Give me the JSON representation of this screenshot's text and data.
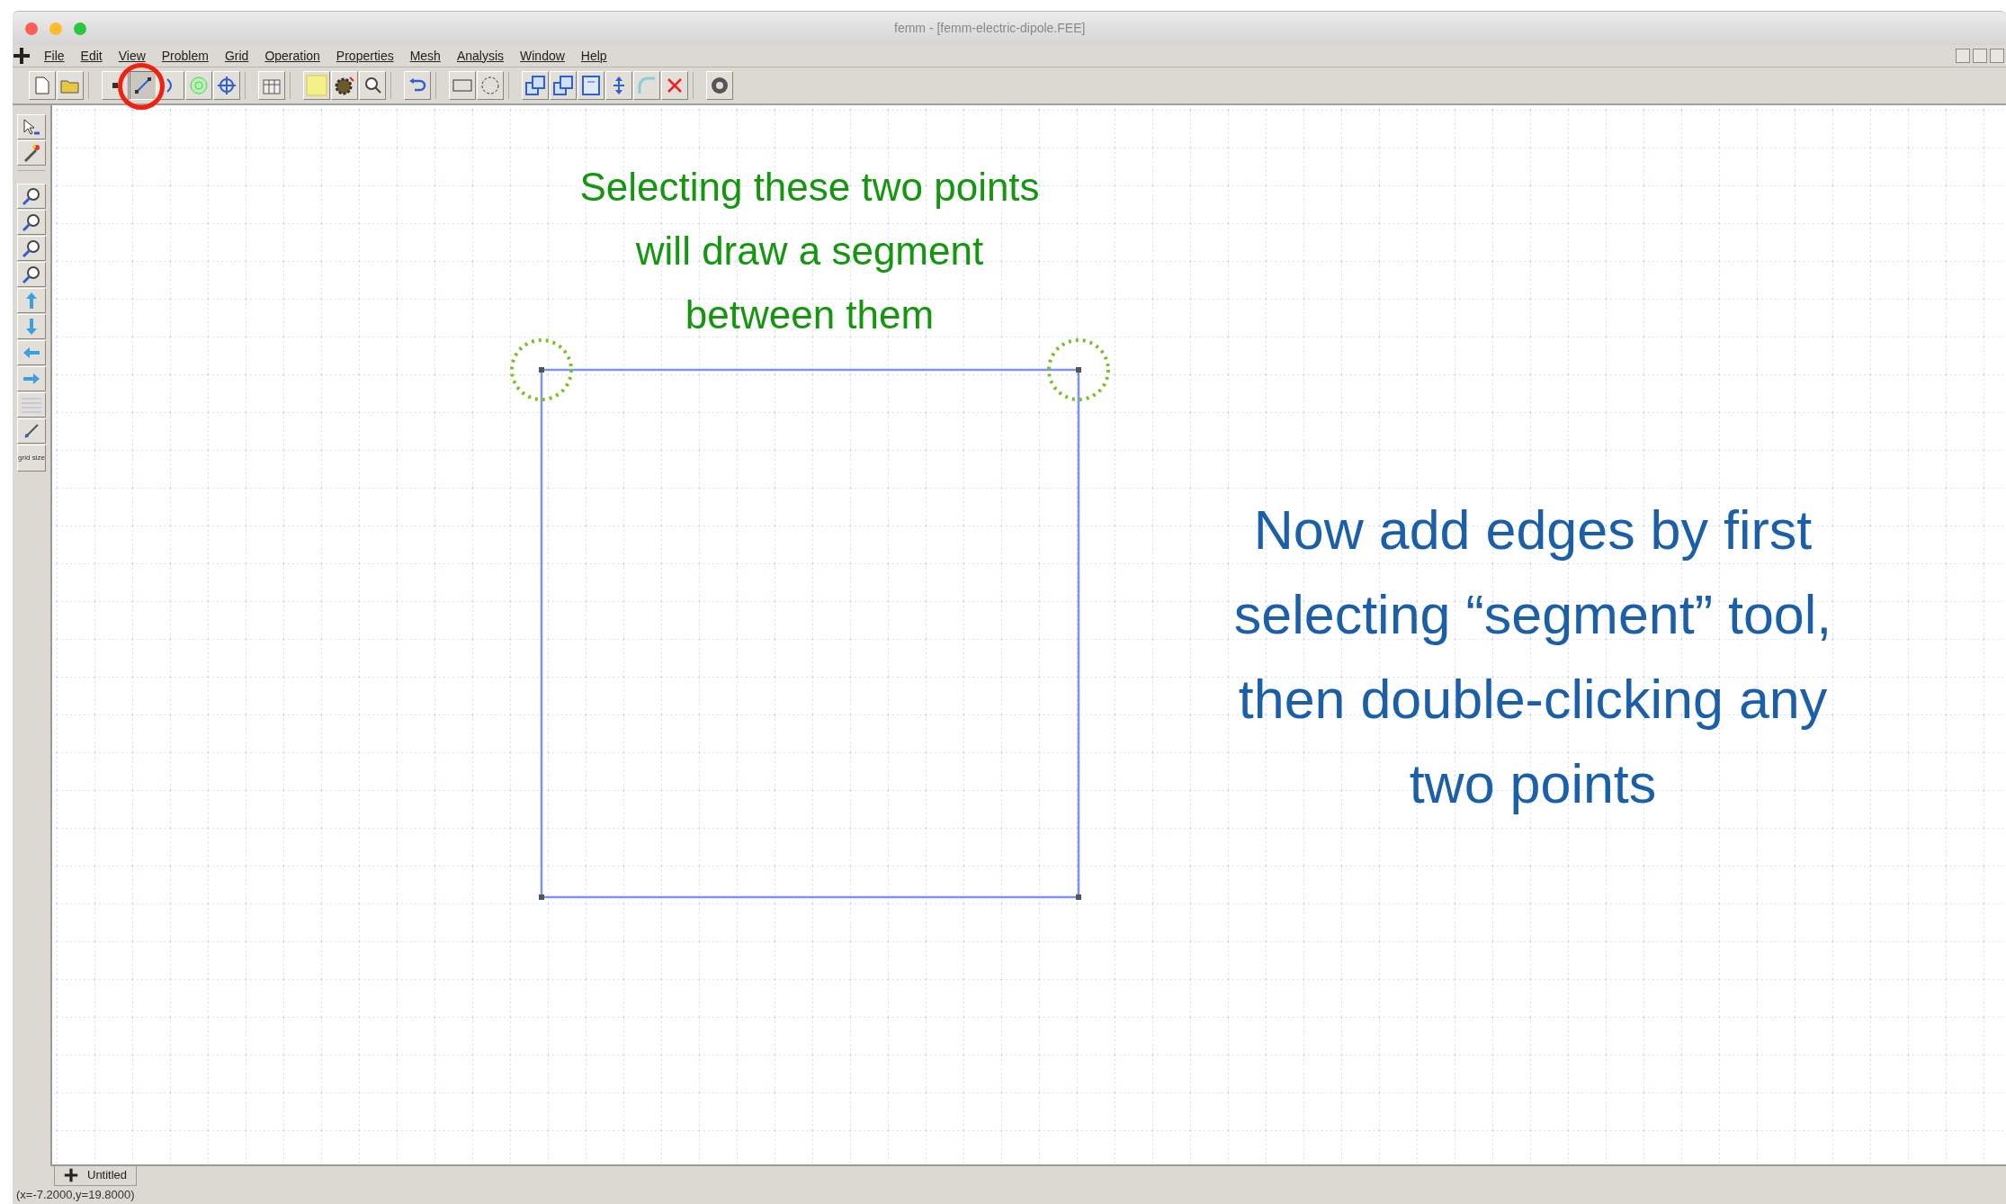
{
  "window": {
    "title": "femm - [femm-electric-dipole.FEE]"
  },
  "menu": [
    "File",
    "Edit",
    "View",
    "Problem",
    "Grid",
    "Operation",
    "Properties",
    "Mesh",
    "Analysis",
    "Window",
    "Help"
  ],
  "toolbar": [
    {
      "kind": "new",
      "selected": false
    },
    {
      "kind": "open",
      "selected": false
    },
    {
      "kind": "sep"
    },
    {
      "kind": "node",
      "selected": false
    },
    {
      "kind": "segment",
      "selected": true
    },
    {
      "kind": "arc",
      "selected": false
    },
    {
      "kind": "block",
      "selected": false
    },
    {
      "kind": "group",
      "selected": false
    },
    {
      "kind": "sep"
    },
    {
      "kind": "mesh",
      "selected": false
    },
    {
      "kind": "sep"
    },
    {
      "kind": "material",
      "selected": false
    },
    {
      "kind": "run",
      "selected": false
    },
    {
      "kind": "view",
      "selected": false
    },
    {
      "kind": "sep"
    },
    {
      "kind": "undo",
      "selected": false
    },
    {
      "kind": "sep"
    },
    {
      "kind": "rect",
      "selected": false
    },
    {
      "kind": "circle",
      "selected": false
    },
    {
      "kind": "sep"
    },
    {
      "kind": "copy",
      "selected": false
    },
    {
      "kind": "move",
      "selected": false
    },
    {
      "kind": "scale",
      "selected": false
    },
    {
      "kind": "mirror",
      "selected": false
    },
    {
      "kind": "fillet",
      "selected": false
    },
    {
      "kind": "delete",
      "selected": false
    },
    {
      "kind": "sep"
    },
    {
      "kind": "settings",
      "selected": false
    }
  ],
  "side_toolbar": [
    {
      "kind": "props"
    },
    {
      "kind": "point"
    },
    {
      "kind": "sep"
    },
    {
      "kind": "zoomin"
    },
    {
      "kind": "zoomout"
    },
    {
      "kind": "zoomfit"
    },
    {
      "kind": "zoomwin"
    },
    {
      "kind": "up"
    },
    {
      "kind": "down"
    },
    {
      "kind": "left"
    },
    {
      "kind": "right"
    },
    {
      "kind": "grid"
    },
    {
      "kind": "snap"
    },
    {
      "kind": "gridsize",
      "label": "grid size"
    }
  ],
  "annotations": [
    {
      "kind": "green",
      "lines": [
        "Selecting these two points",
        "will draw a segment",
        "between them"
      ]
    },
    {
      "kind": "blue",
      "lines": [
        "Now add edges by first",
        "selecting “segment” tool,",
        "then double-clicking any",
        "two points"
      ]
    }
  ],
  "tab": {
    "label": "Untitled"
  },
  "status_bar": "(x=-7.2000,y=19.8000)"
}
